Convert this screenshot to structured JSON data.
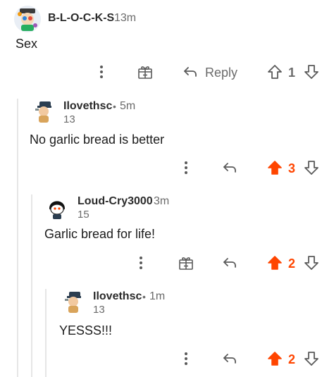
{
  "colors": {
    "upvote": "#ff4500",
    "muted": "#6b6b6b",
    "text": "#1c1c1c",
    "thread_line": "#e6e6e6"
  },
  "comments": [
    {
      "username": "B-L-O-C-K-S",
      "age": "13m",
      "body": "Sex",
      "actions": {
        "more_icon": "more-vertical-icon",
        "award_icon": "gift-icon",
        "reply_label": "Reply",
        "score": "1",
        "voted": "none"
      }
    },
    {
      "username": "Ilovethsc",
      "separator": "•",
      "age": "5m",
      "karma": "13",
      "body": "No garlic bread is better",
      "actions": {
        "more_icon": "more-vertical-icon",
        "score": "3",
        "voted": "up"
      }
    },
    {
      "username": "Loud-Cry3000",
      "age": "3m",
      "karma": "15",
      "body": "Garlic bread for life!",
      "actions": {
        "more_icon": "more-vertical-icon",
        "award_icon": "gift-icon",
        "score": "2",
        "voted": "up"
      }
    },
    {
      "username": "Ilovethsc",
      "separator": "•",
      "age": "1m",
      "karma": "13",
      "body": "YESSS!!!",
      "actions": {
        "more_icon": "more-vertical-icon",
        "score": "2",
        "voted": "up"
      }
    }
  ]
}
